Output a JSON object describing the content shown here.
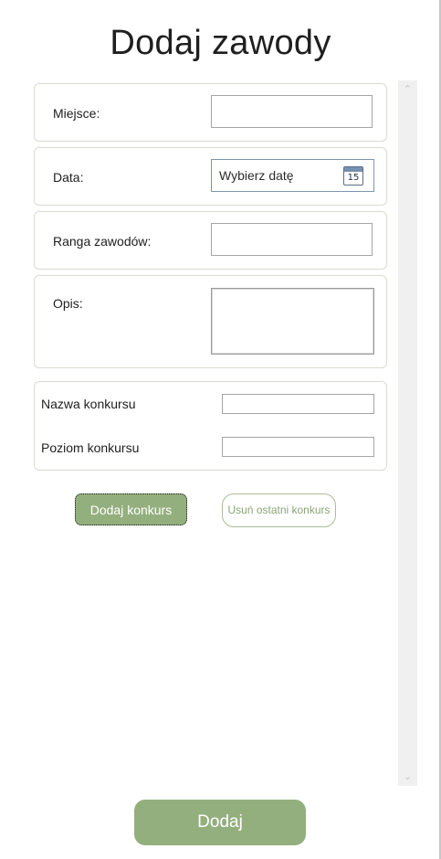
{
  "page": {
    "title": "Dodaj zawody"
  },
  "form": {
    "place": {
      "label": "Miejsce:",
      "value": ""
    },
    "date": {
      "label": "Data:",
      "placeholder": "Wybierz datę",
      "calendar_day": "15"
    },
    "rank": {
      "label": "Ranga zawodów:",
      "value": ""
    },
    "description": {
      "label": "Opis:",
      "value": ""
    }
  },
  "competition": {
    "name_label": "Nazwa konkursu",
    "level_label": "Poziom konkursu"
  },
  "buttons": {
    "add_competition": "Dodaj konkurs",
    "remove_last": "Usuń ostatni konkurs",
    "submit": "Dodaj"
  },
  "scrollbar": {
    "up_icon": "chevron-up-icon",
    "down_icon": "chevron-down-icon"
  },
  "colors": {
    "accent": "#94af7e",
    "border": "#d8dccf",
    "date_border": "#7d95b0"
  }
}
